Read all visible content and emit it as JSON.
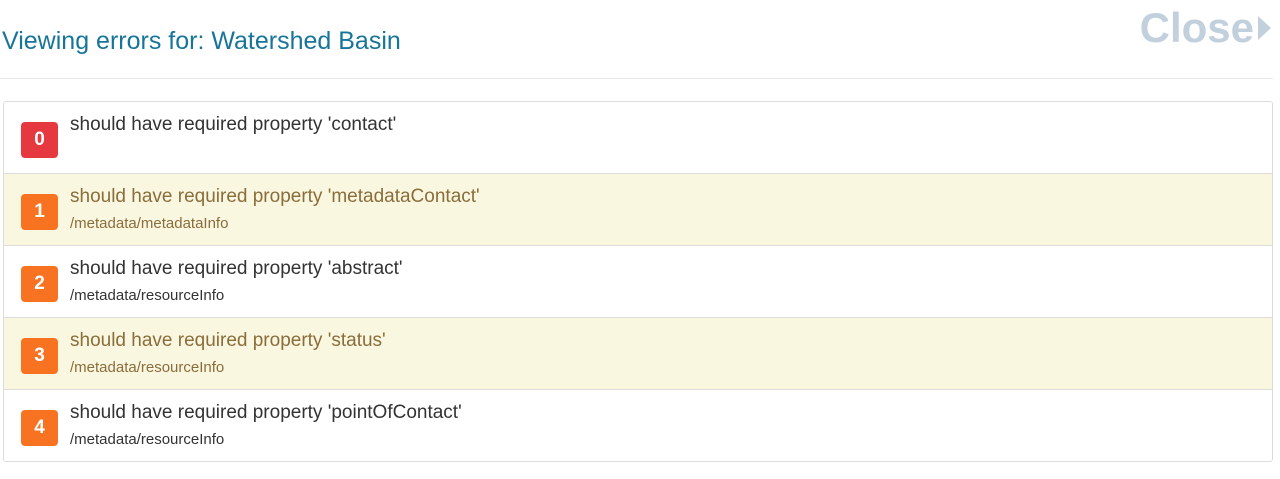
{
  "header": {
    "title": "Viewing errors for: Watershed Basin",
    "close_label": "Close"
  },
  "errors": [
    {
      "index": "0",
      "message": "should have required property 'contact'",
      "path": "",
      "severity": "error"
    },
    {
      "index": "1",
      "message": "should have required property 'metadataContact'",
      "path": "/metadata/metadataInfo",
      "severity": "warning"
    },
    {
      "index": "2",
      "message": "should have required property 'abstract'",
      "path": "/metadata/resourceInfo",
      "severity": "warning"
    },
    {
      "index": "3",
      "message": "should have required property 'status'",
      "path": "/metadata/resourceInfo",
      "severity": "warning"
    },
    {
      "index": "4",
      "message": "should have required property 'pointOfContact'",
      "path": "/metadata/resourceInfo",
      "severity": "warning"
    }
  ],
  "colors": {
    "title": "#17759a",
    "close": "#c2d0dd",
    "badge_error": "#e5393f",
    "badge_warning": "#f77322",
    "highlight_row": "#f9f7e0",
    "highlight_text": "#8a6d3b"
  }
}
